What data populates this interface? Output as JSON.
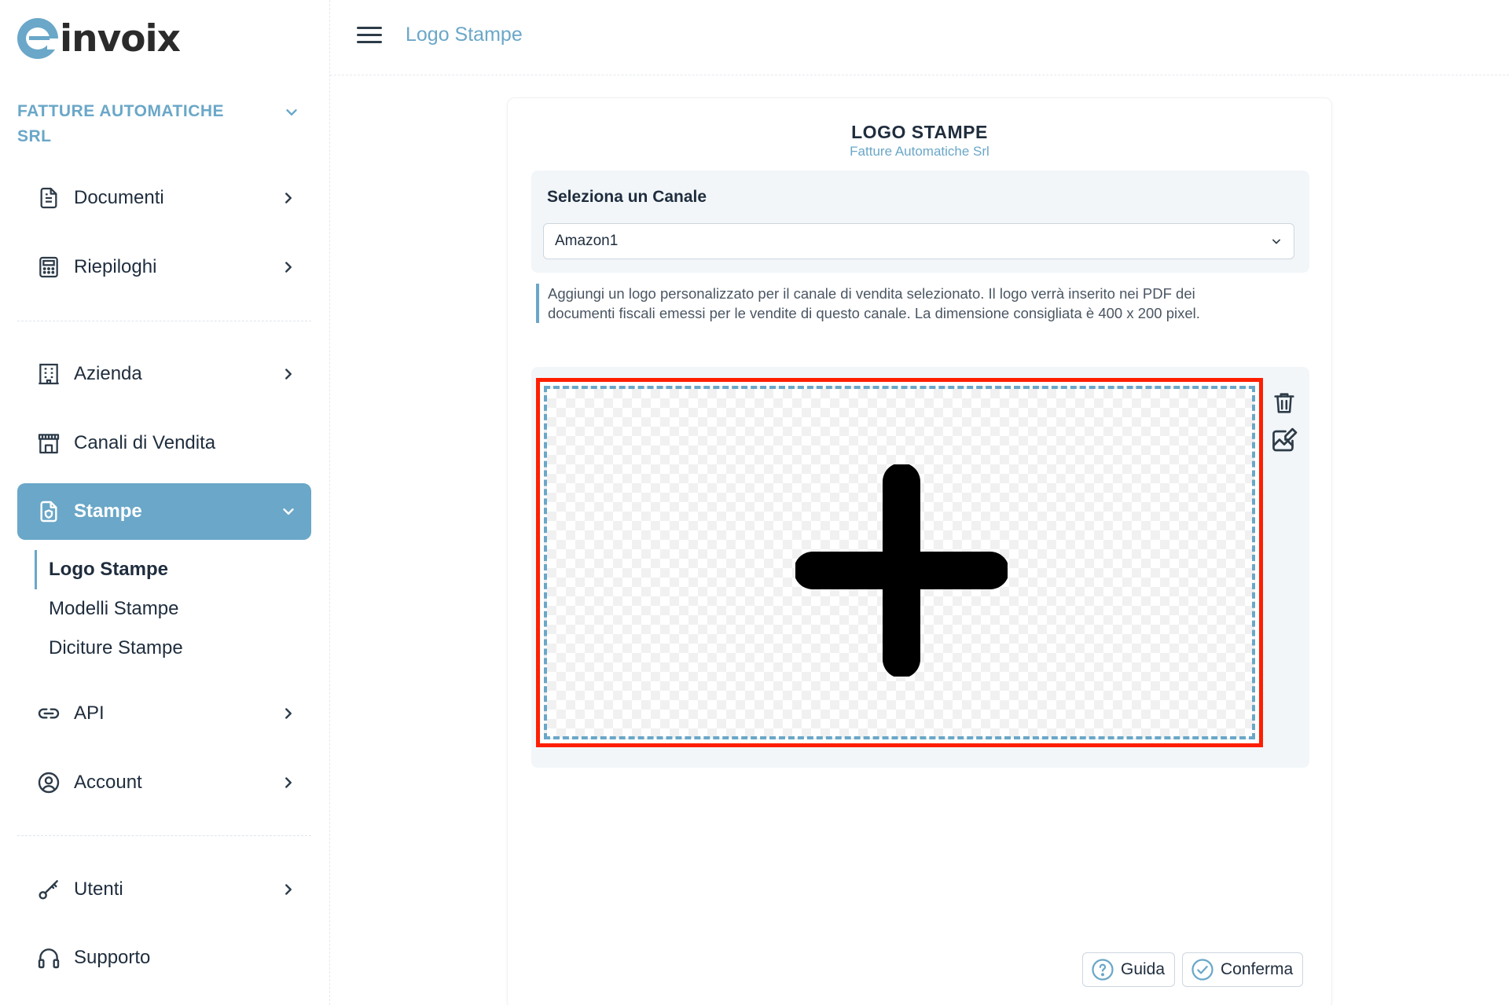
{
  "brand": {
    "name": "invoix",
    "accent": "#6aa7c8"
  },
  "sidebar": {
    "company": "FATTURE AUTOMATICHE SRL",
    "items": [
      {
        "label": "Documenti",
        "icon": "document-icon"
      },
      {
        "label": "Riepiloghi",
        "icon": "calculator-icon"
      },
      {
        "label": "Azienda",
        "icon": "building-icon"
      },
      {
        "label": "Canali di Vendita",
        "icon": "store-icon"
      },
      {
        "label": "Stampe",
        "icon": "print-file-icon"
      },
      {
        "label": "API",
        "icon": "link-icon"
      },
      {
        "label": "Account",
        "icon": "user-circle-icon"
      },
      {
        "label": "Utenti",
        "icon": "key-icon"
      },
      {
        "label": "Supporto",
        "icon": "headset-icon"
      }
    ],
    "subitems": [
      "Logo Stampe",
      "Modelli Stampe",
      "Diciture Stampe"
    ]
  },
  "topbar": {
    "title": "Logo Stampe"
  },
  "card": {
    "title": "LOGO STAMPE",
    "subtitle": "Fatture Automatiche Srl",
    "select_label": "Seleziona un Canale",
    "select_value": "Amazon1",
    "info_line1": "Aggiungi un logo personalizzato per il canale di vendita selezionato. Il logo verrà inserito nei PDF dei",
    "info_line2": "documenti fiscali emessi per le vendite di questo canale. La dimensione consigliata è 400 x 200 pixel."
  },
  "buttons": {
    "guide": "Guida",
    "confirm": "Conferma"
  }
}
